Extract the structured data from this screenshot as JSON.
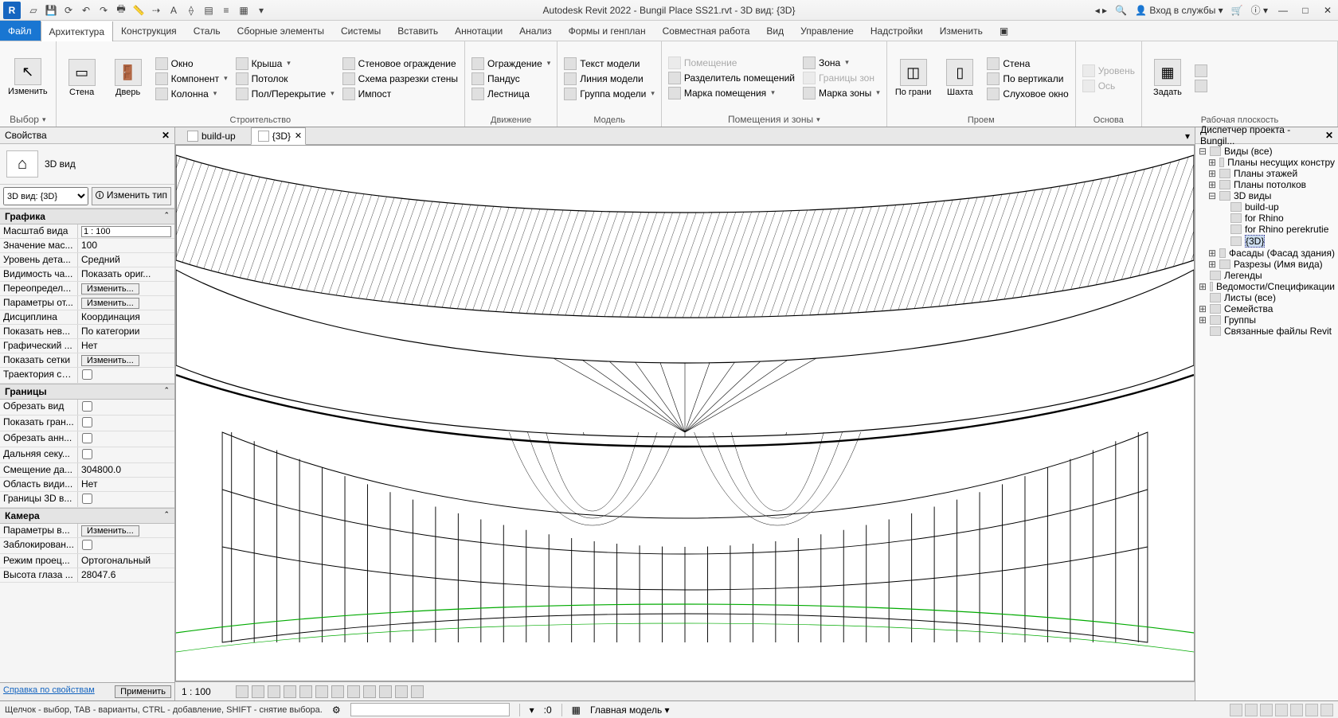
{
  "title": "Autodesk Revit 2022 - Bungil Place SS21.rvt - 3D вид: {3D}",
  "app_logo": "R",
  "title_right": {
    "login": "Вход в службы",
    "help": "?"
  },
  "menu": {
    "file": "Файл",
    "tabs": [
      "Архитектура",
      "Конструкция",
      "Сталь",
      "Сборные элементы",
      "Системы",
      "Вставить",
      "Аннотации",
      "Анализ",
      "Формы и генплан",
      "Совместная работа",
      "Вид",
      "Управление",
      "Надстройки",
      "Изменить"
    ]
  },
  "ribbon": {
    "select": {
      "modify": "Изменить",
      "label": "Выбор"
    },
    "build": {
      "wall": "Стена",
      "door": "Дверь",
      "window": "Окно",
      "component": "Компонент",
      "column": "Колонна",
      "roof": "Крыша",
      "ceiling": "Потолок",
      "floor": "Пол/Перекрытие",
      "curtainwall": "Стеновое ограждение",
      "curtaingrid": "Схема разрезки стены",
      "mullion": "Импост",
      "label": "Строительство"
    },
    "circ": {
      "railing": "Ограждение",
      "ramp": "Пандус",
      "stair": "Лестница",
      "label": "Движение"
    },
    "model": {
      "text": "Текст модели",
      "line": "Линия  модели",
      "group": "Группа модели",
      "label": "Модель"
    },
    "room": {
      "room": "Помещение",
      "sep": "Разделитель помещений",
      "tag": "Марка помещения",
      "area": "Зона",
      "abound": "Границы  зон",
      "atag": "Марка  зоны",
      "label": "Помещения и зоны"
    },
    "opening": {
      "byface": "По грани",
      "shaft": "Шахта",
      "wall": "Стена",
      "vert": "По вертикали",
      "dormer": "Слуховое окно",
      "label": "Проем"
    },
    "datum": {
      "level": "Уровень",
      "grid": "Ось",
      "label": "Основа"
    },
    "wp": {
      "set": "Задать",
      "label": "Рабочая плоскость"
    }
  },
  "properties": {
    "title": "Свойства",
    "type_name": "3D вид",
    "selector": "3D вид: {3D}",
    "edit_type": "Изменить тип",
    "groups": [
      {
        "name": "Графика",
        "expandable": true,
        "rows": [
          {
            "k": "Масштаб вида",
            "v": "1 : 100",
            "type": "input"
          },
          {
            "k": "Значение мас...",
            "v": "100"
          },
          {
            "k": "Уровень дета...",
            "v": "Средний"
          },
          {
            "k": "Видимость ча...",
            "v": "Показать ориг..."
          },
          {
            "k": "Переопредел...",
            "v": "Изменить...",
            "type": "btn"
          },
          {
            "k": "Параметры от...",
            "v": "Изменить...",
            "type": "btn"
          },
          {
            "k": "Дисциплина",
            "v": "Координация"
          },
          {
            "k": "Показать нев...",
            "v": "По категории"
          },
          {
            "k": "Графический ...",
            "v": "Нет"
          },
          {
            "k": "Показать сетки",
            "v": "Изменить...",
            "type": "btn"
          },
          {
            "k": "Траектория со...",
            "v": "",
            "type": "check"
          }
        ]
      },
      {
        "name": "Границы",
        "expandable": true,
        "rows": [
          {
            "k": "Обрезать вид",
            "v": "",
            "type": "check"
          },
          {
            "k": "Показать гран...",
            "v": "",
            "type": "check"
          },
          {
            "k": "Обрезать анн...",
            "v": "",
            "type": "check"
          },
          {
            "k": "Дальняя секу...",
            "v": "",
            "type": "check"
          },
          {
            "k": "Смещение да...",
            "v": "304800.0"
          },
          {
            "k": "Область види...",
            "v": "Нет"
          },
          {
            "k": "Границы 3D в...",
            "v": "",
            "type": "check"
          }
        ]
      },
      {
        "name": "Камера",
        "expandable": true,
        "rows": [
          {
            "k": "Параметры в...",
            "v": "Изменить...",
            "type": "btn"
          },
          {
            "k": "Заблокирован...",
            "v": "",
            "type": "check"
          },
          {
            "k": "Режим проец...",
            "v": "Ортогональный"
          },
          {
            "k": "Высота глаза ...",
            "v": "28047.6"
          }
        ]
      }
    ],
    "help_link": "Справка по свойствам",
    "apply": "Применить"
  },
  "viewtabs": [
    {
      "label": "build-up",
      "active": false
    },
    {
      "label": "{3D}",
      "active": true
    }
  ],
  "viewbar": {
    "scale": "1 : 100"
  },
  "browser": {
    "title": "Диспетчер проекта - Bungil...",
    "items": [
      {
        "lvl": 0,
        "tw": "–",
        "label": "Виды (все)"
      },
      {
        "lvl": 1,
        "tw": "+",
        "label": "Планы несущих констру"
      },
      {
        "lvl": 1,
        "tw": "+",
        "label": "Планы этажей"
      },
      {
        "lvl": 1,
        "tw": "+",
        "label": "Планы потолков"
      },
      {
        "lvl": 1,
        "tw": "–",
        "label": "3D виды"
      },
      {
        "lvl": 2,
        "tw": "",
        "label": "build-up"
      },
      {
        "lvl": 2,
        "tw": "",
        "label": "for Rhino"
      },
      {
        "lvl": 2,
        "tw": "",
        "label": "for Rhino perekrutie"
      },
      {
        "lvl": 2,
        "tw": "",
        "label": "{3D}",
        "sel": true
      },
      {
        "lvl": 1,
        "tw": "+",
        "label": "Фасады (Фасад здания)"
      },
      {
        "lvl": 1,
        "tw": "+",
        "label": "Разрезы (Имя вида)"
      },
      {
        "lvl": 0,
        "tw": "",
        "label": "Легенды"
      },
      {
        "lvl": 0,
        "tw": "+",
        "label": "Ведомости/Спецификации"
      },
      {
        "lvl": 0,
        "tw": "",
        "label": "Листы (все)"
      },
      {
        "lvl": 0,
        "tw": "+",
        "label": "Семейства"
      },
      {
        "lvl": 0,
        "tw": "+",
        "label": "Группы"
      },
      {
        "lvl": 0,
        "tw": "",
        "label": "Связанные файлы Revit"
      }
    ]
  },
  "status": {
    "hint": "Щелчок - выбор, TAB - варианты, CTRL - добавление, SHIFT - снятие выбора.",
    "sel": ":0",
    "model": "Главная модель"
  }
}
